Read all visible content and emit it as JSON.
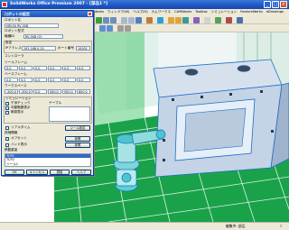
{
  "window": {
    "title": "SolidWorks Office Premium 2007 - [部品1 *]"
  },
  "menubar": [
    "ファイル(F)",
    "編集(E)",
    "表示(V)",
    "挿入(I)",
    "ツール(T)",
    "PhotoWorks",
    "ウィンドウ(W)",
    "ヘルプ(H)",
    "カムワークス",
    "CAMWorks",
    "Toolbox",
    "シミュレーション",
    "FeatureWorks",
    "eDrawings"
  ],
  "dialog": {
    "title": "ロボットの設定",
    "sections": {
      "robot_name": "ロボット名",
      "robot_model": "ロボット型式",
      "robot_id_label": "機種ID",
      "robot_id_value": "RV-3SB (Q)",
      "settings": "設定",
      "ip": "IPアドレス",
      "port": "ポート番号",
      "controller": "コントローラ",
      "tool": "ツールフレーム",
      "base": "ベースフレーム",
      "workspace": "ワークスペース",
      "simulation": "シミュレーション",
      "table_label": "テーブル",
      "info_label": "詳細情報",
      "load_label": "積載重量"
    },
    "robot_name_value": "MELFA RV-3SB",
    "ip_value": "192.168.0.20",
    "port_value": "10001",
    "tool_values": [
      "0.0",
      "0.0",
      "0.0",
      "0.0",
      "0.0",
      "0.0"
    ],
    "base_values": [
      "0.0",
      "0.0",
      "0.0",
      "0.0",
      "0.0",
      "0.0"
    ],
    "work_values": [
      "-500.0",
      "-500.0",
      "0.0",
      "500.0",
      "500.0",
      "800.0"
    ],
    "checkboxes": [
      {
        "label": "干渉チェック",
        "checked": true
      },
      {
        "label": "可動範囲表示",
        "checked": false
      },
      {
        "label": "軌跡表示",
        "checked": false
      },
      {
        "label": "リアルタイム",
        "checked": false
      },
      {
        "label": "オフセット",
        "checked": true
      },
      {
        "label": "ハンド表示",
        "checked": false
      }
    ],
    "list_items": [
      "TCP1",
      "TCP2",
      "ツール1"
    ],
    "tool_button": "ツール設定",
    "ref_buttons": [
      "参照",
      "参照"
    ],
    "ok_button": "OK",
    "cancel_button": "キャンセル",
    "apply_button": "適用",
    "help_button": "ヘルプ"
  },
  "statusbar": {
    "left": "",
    "center": "編集中: 部品",
    "right": "?"
  },
  "colors": {
    "titlebar": "#1d55c4",
    "floor": "#1aa24a",
    "part": "#c9d6e6",
    "part_edge": "#1b6fc7",
    "robot": "#4cc6c9"
  }
}
